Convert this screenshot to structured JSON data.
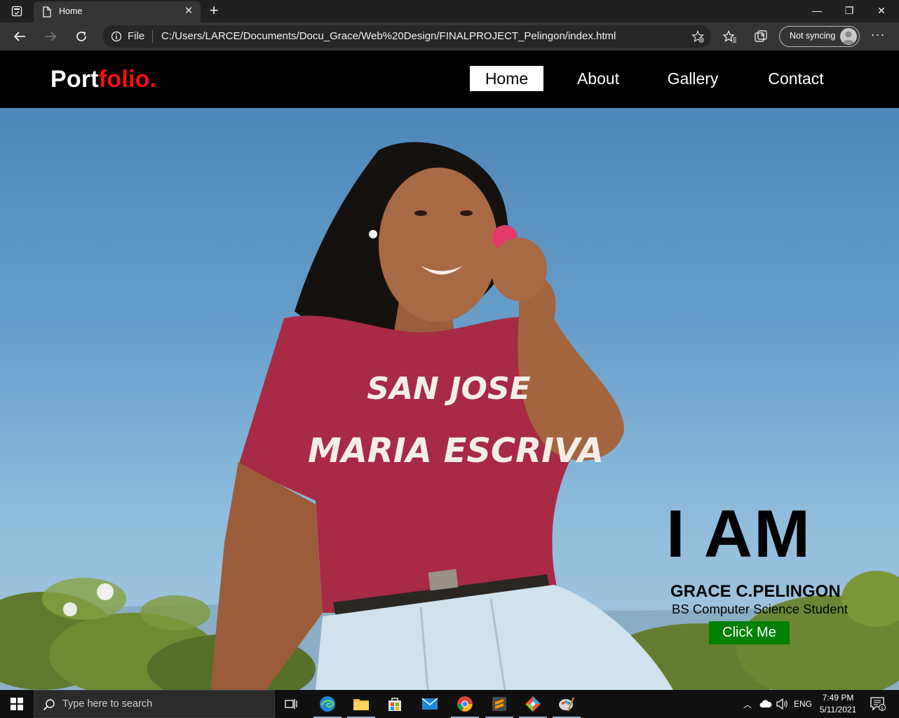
{
  "browser": {
    "tab_title": "Home",
    "address_scheme": "File",
    "url": "C:/Users/LARCE/Documents/Docu_Grace/Web%20Design/FINALPROJECT_Pelingon/index.html",
    "sync_label": "Not syncing",
    "new_tab_symbol": "+",
    "more_symbol": "···"
  },
  "site": {
    "logo_part1": "Port",
    "logo_part2": "folio.",
    "nav": [
      {
        "label": "Home",
        "active": true
      },
      {
        "label": "About",
        "active": false
      },
      {
        "label": "Gallery",
        "active": false
      },
      {
        "label": "Contact",
        "active": false
      }
    ],
    "hero": {
      "heading": "I AM",
      "name": "GRACE C.PELINGON",
      "role": "BS Computer Science Student",
      "button_label": "Click Me",
      "shirt_line1": "SAN JOSE",
      "shirt_line2": "MARIA ESCRIVA"
    }
  },
  "taskbar": {
    "search_placeholder": "Type here to search",
    "language": "ENG",
    "time": "7:49 PM",
    "date": "5/11/2021",
    "notification_count": "1"
  },
  "colors": {
    "logo_accent": "#ff0d0d",
    "button_green": "#008000",
    "nav_bg": "#000000",
    "shirt": "#a82a45"
  }
}
